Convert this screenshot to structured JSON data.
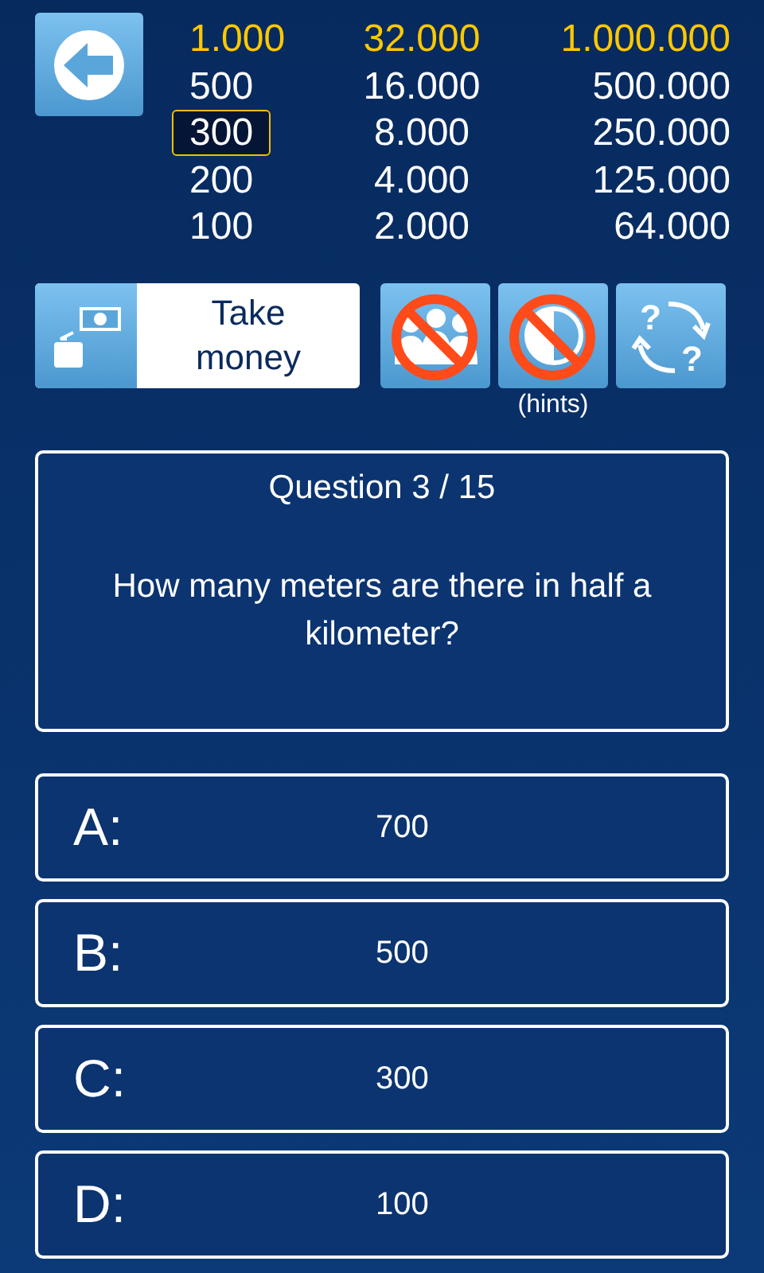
{
  "ladder": [
    [
      {
        "amount": "1.000",
        "milestone": true,
        "selected": false
      },
      {
        "amount": "32.000",
        "milestone": true,
        "selected": false
      },
      {
        "amount": "1.000.000",
        "milestone": true,
        "selected": false
      }
    ],
    [
      {
        "amount": "500",
        "milestone": false,
        "selected": false
      },
      {
        "amount": "16.000",
        "milestone": false,
        "selected": false
      },
      {
        "amount": "500.000",
        "milestone": false,
        "selected": false
      }
    ],
    [
      {
        "amount": "300",
        "milestone": false,
        "selected": true
      },
      {
        "amount": "8.000",
        "milestone": false,
        "selected": false
      },
      {
        "amount": "250.000",
        "milestone": false,
        "selected": false
      }
    ],
    [
      {
        "amount": "200",
        "milestone": false,
        "selected": false
      },
      {
        "amount": "4.000",
        "milestone": false,
        "selected": false
      },
      {
        "amount": "125.000",
        "milestone": false,
        "selected": false
      }
    ],
    [
      {
        "amount": "100",
        "milestone": false,
        "selected": false
      },
      {
        "amount": "2.000",
        "milestone": false,
        "selected": false
      },
      {
        "amount": "64.000",
        "milestone": false,
        "selected": false
      }
    ]
  ],
  "take_money": {
    "label": "Take money"
  },
  "hints": [
    {
      "kind": "audience",
      "used": true
    },
    {
      "kind": "fifty",
      "used": true
    },
    {
      "kind": "swap",
      "marks": [
        "?",
        "?"
      ],
      "used": false
    }
  ],
  "hints_caption": "(hints)",
  "question": {
    "title": "Question 3 / 15",
    "text": "How many meters are there in half a kilometer?"
  },
  "answers": [
    {
      "letter": "A:",
      "value": "700"
    },
    {
      "letter": "B:",
      "value": "500"
    },
    {
      "letter": "C:",
      "value": "300"
    },
    {
      "letter": "D:",
      "value": "100"
    }
  ]
}
